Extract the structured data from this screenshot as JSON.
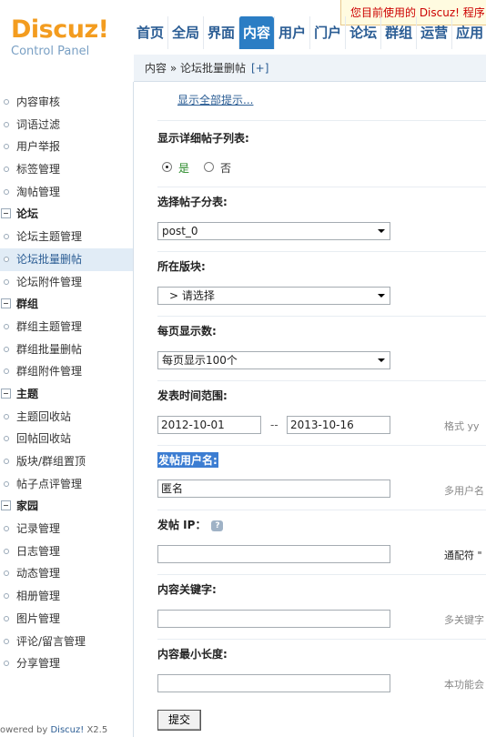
{
  "header": {
    "logo_brand": "Discuz!",
    "logo_sub": "Control Panel",
    "notice": "您目前使用的 Discuz! 程序",
    "nav": [
      "首页",
      "全局",
      "界面",
      "内容",
      "用户",
      "门户",
      "论坛",
      "群组",
      "运营",
      "应用"
    ],
    "active_nav": "内容",
    "breadcrumb": "内容 » 论坛批量删帖",
    "breadcrumb_add": "[+]"
  },
  "sidebar": {
    "items": [
      {
        "label": "内容审核",
        "type": "item"
      },
      {
        "label": "词语过滤",
        "type": "item"
      },
      {
        "label": "用户举报",
        "type": "item"
      },
      {
        "label": "标签管理",
        "type": "item"
      },
      {
        "label": "淘帖管理",
        "type": "item"
      },
      {
        "label": "论坛",
        "type": "group"
      },
      {
        "label": "论坛主题管理",
        "type": "item"
      },
      {
        "label": "论坛批量删帖",
        "type": "item",
        "active": true
      },
      {
        "label": "论坛附件管理",
        "type": "item"
      },
      {
        "label": "群组",
        "type": "group"
      },
      {
        "label": "群组主题管理",
        "type": "item"
      },
      {
        "label": "群组批量删帖",
        "type": "item"
      },
      {
        "label": "群组附件管理",
        "type": "item"
      },
      {
        "label": "主题",
        "type": "group"
      },
      {
        "label": "主题回收站",
        "type": "item"
      },
      {
        "label": "回帖回收站",
        "type": "item"
      },
      {
        "label": "版块/群组置顶",
        "type": "item"
      },
      {
        "label": "帖子点评管理",
        "type": "item"
      },
      {
        "label": "家园",
        "type": "group"
      },
      {
        "label": "记录管理",
        "type": "item"
      },
      {
        "label": "日志管理",
        "type": "item"
      },
      {
        "label": "动态管理",
        "type": "item"
      },
      {
        "label": "相册管理",
        "type": "item"
      },
      {
        "label": "图片管理",
        "type": "item"
      },
      {
        "label": "评论/留言管理",
        "type": "item"
      },
      {
        "label": "分享管理",
        "type": "item"
      }
    ],
    "powered_prefix": "owered by ",
    "powered_brand": "Discuz!",
    "powered_version": " X2.5"
  },
  "form": {
    "show_tips": "显示全部提示...",
    "detail_list_label": "显示详细帖子列表:",
    "radio_yes": "是",
    "radio_no": "否",
    "radio_selected": "是",
    "post_table_label": "选择帖子分表:",
    "post_table_value": "post_0",
    "forum_label": "所在版块:",
    "forum_value": "> 请选择",
    "per_page_label": "每页显示数:",
    "per_page_value": "每页显示100个",
    "time_range_label": "发表时间范围:",
    "time_start": "2012-10-01",
    "time_sep": "--",
    "time_end": "2013-10-16",
    "time_hint": "格式 yy",
    "author_label": "发帖用户名:",
    "author_value": "匿名",
    "author_hint": "多用户名",
    "ip_label": "发帖 IP：",
    "ip_help_icon": "?",
    "ip_value": "",
    "ip_hint": "通配符 \"",
    "keyword_label": "内容关键字:",
    "keyword_value": "",
    "keyword_hint": "多关键字",
    "minlen_label": "内容最小长度:",
    "minlen_value": "",
    "minlen_hint": "本功能会",
    "submit_label": "提交"
  }
}
